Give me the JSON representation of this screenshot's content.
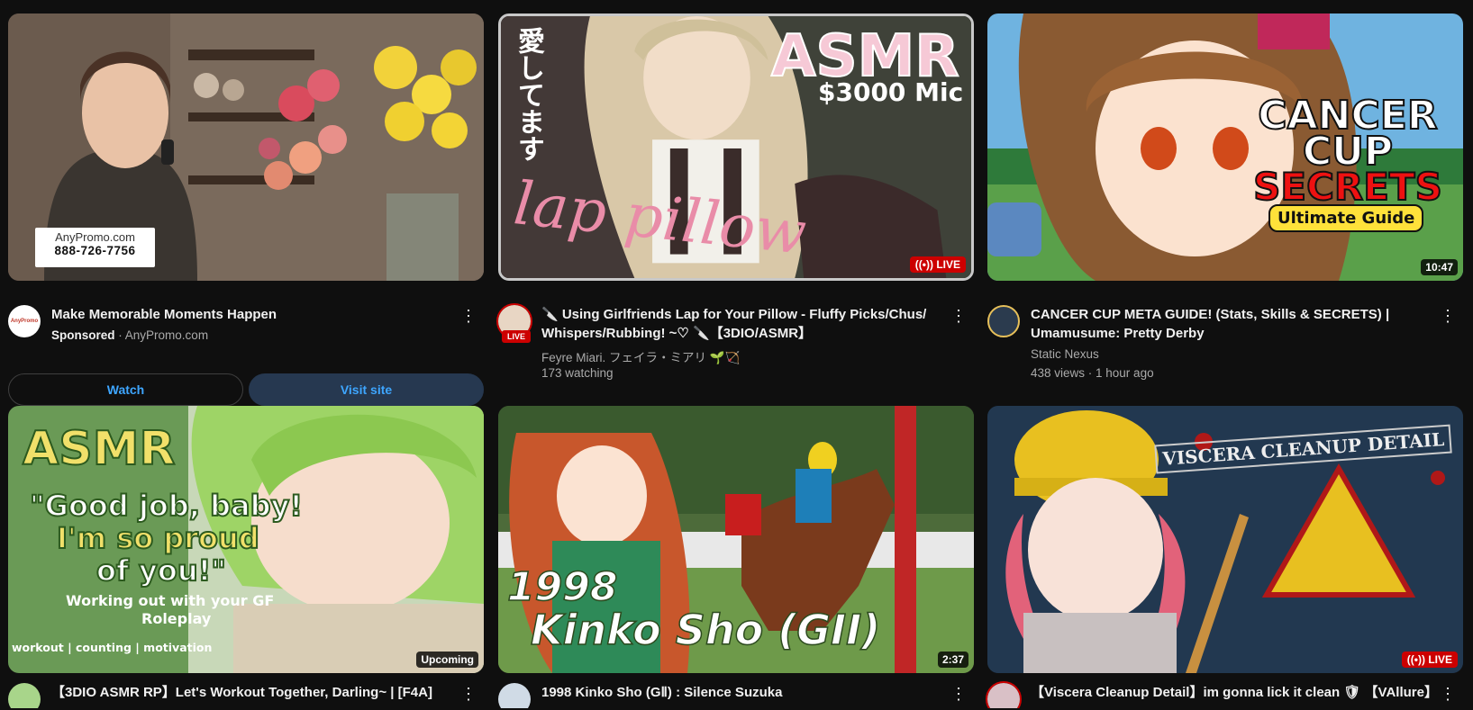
{
  "cards": [
    {
      "title": "Make Memorable Moments Happen",
      "sponsored_label": "Sponsored",
      "advertiser": "· AnyPromo.com",
      "ad_overlay": {
        "brand": "AnyPromo.com",
        "phone": "888-726-7756"
      },
      "watch_label": "Watch",
      "visit_label": "Visit site",
      "avatar_text": "AnyPromo",
      "thumb_icon": "florist-on-phone-photo"
    },
    {
      "title": "🔪 Using Girlfriends Lap for Your Pillow - Fluffy Picks/Chus/ Whispers/Rubbing! ~♡ 🔪【3DIO/ASMR】",
      "channel": "Feyre Miari. フェイラ・ミアリ 🌱🏹",
      "stats": "173 watching",
      "badge": "LIVE",
      "avatar_badge": "LIVE",
      "thumb_text": {
        "a": "ASMR",
        "b": "$3000 Mic",
        "c": "lap pillow",
        "d": "愛してます"
      }
    },
    {
      "title": "CANCER CUP META GUIDE! (Stats, Skills & SECRETS) | Umamusume: Pretty Derby",
      "channel": "Static Nexus",
      "stats": "438 views · 1 hour ago",
      "duration": "10:47",
      "thumb_text": {
        "a": "CANCER",
        "b": "CUP",
        "c": "SECRETS",
        "d": "Ultimate Guide"
      }
    },
    {
      "title": "【3DIO ASMR RP】Let's Workout Together, Darling~ | [F4A]",
      "badge": "Upcoming",
      "thumb_text": {
        "a": "ASMR",
        "b": "\"Good job, baby!",
        "c": "I'm so proud",
        "d": "of you!\"",
        "e": "Working out with your GF",
        "f": "Roleplay",
        "g": "workout | counting | motivation"
      }
    },
    {
      "title": "1998 Kinko Sho (GⅡ) : Silence Suzuka",
      "duration": "2:37",
      "thumb_text": {
        "a": "1998",
        "b": "Kinko Sho (GII)"
      }
    },
    {
      "title": "【Viscera Cleanup Detail】im gonna lick it clean 🛡 【VAllure】",
      "badge": "LIVE",
      "thumb_text": {
        "a": "VISCERA CLEANUP DETAIL"
      }
    }
  ],
  "colors": {
    "bg": "#0f0f0f",
    "accent": "#3ea6ff",
    "live": "#cc0000",
    "secondary_text": "#aaaaaa"
  },
  "icons": {
    "kebab": "more-vert-icon",
    "live": "live-broadcast-icon"
  }
}
